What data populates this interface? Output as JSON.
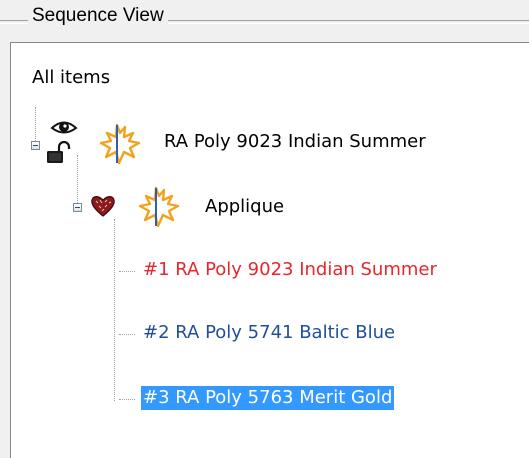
{
  "group": {
    "title": "Sequence View"
  },
  "tree": {
    "root_label": "All items",
    "pattern": {
      "label": "RA Poly 9023 Indian Summer",
      "icons": [
        "eye-icon",
        "unlock-icon",
        "maple-leaf-icon"
      ]
    },
    "applique": {
      "label": "Applique",
      "icons": [
        "heart-icon",
        "maple-leaf-icon"
      ]
    },
    "threads": [
      {
        "label": "#1 RA Poly 9023 Indian Summer",
        "color": "#e8262c"
      },
      {
        "label": "#2 RA Poly 5741 Baltic Blue",
        "color": "#1f4f99"
      },
      {
        "label": "#3 RA Poly 5763 Merit Gold",
        "color": "#1f4f99",
        "selected": true
      }
    ],
    "selection_color": "#3399ff"
  }
}
